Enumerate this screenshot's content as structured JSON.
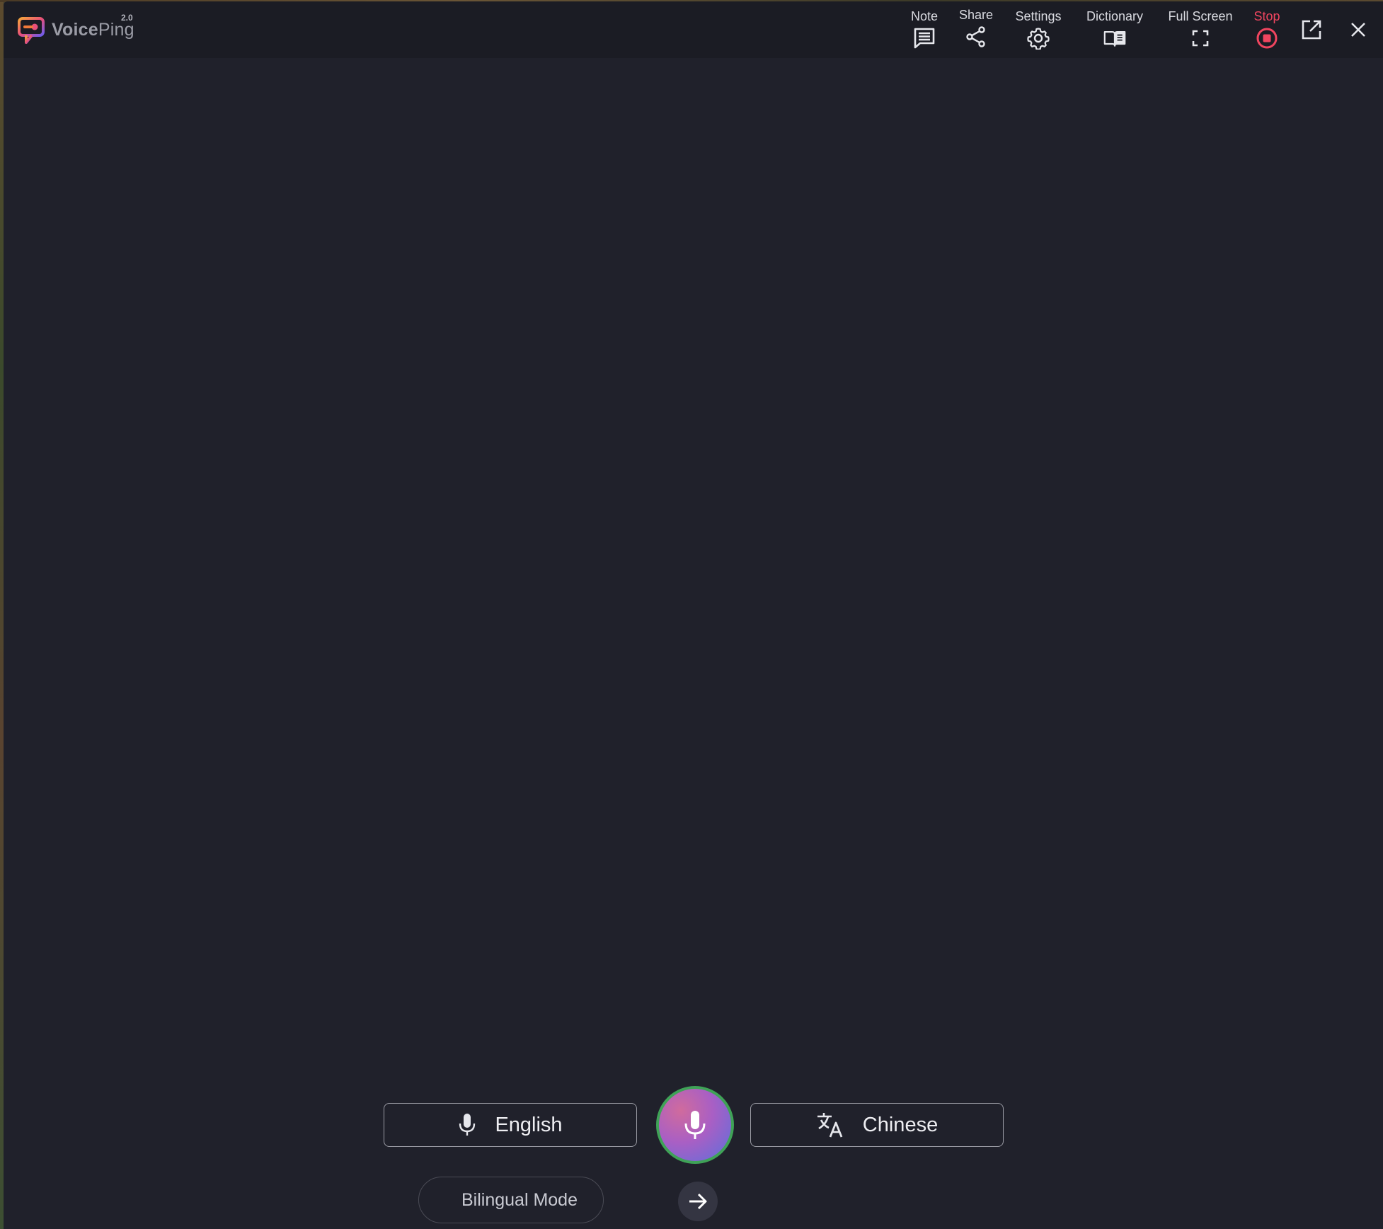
{
  "app": {
    "name_bold": "Voice",
    "name_regular": "Ping",
    "version": "2.0"
  },
  "toolbar": {
    "note": {
      "label": "Note",
      "icon": "note-icon"
    },
    "share": {
      "label": "Share",
      "icon": "share-icon"
    },
    "settings": {
      "label": "Settings",
      "icon": "gear-icon"
    },
    "dictionary": {
      "label": "Dictionary",
      "icon": "book-icon"
    },
    "fullscreen": {
      "label": "Full Screen",
      "icon": "fullscreen-icon"
    },
    "stop": {
      "label": "Stop",
      "icon": "stop-icon"
    },
    "popout": {
      "icon": "external-link-icon"
    },
    "close": {
      "icon": "close-icon"
    }
  },
  "controls": {
    "source_language": "English",
    "target_language": "Chinese",
    "mode_label": "Bilingual Mode"
  },
  "colors": {
    "background": "#20212b",
    "titlebar": "#1b1c24",
    "stop_accent": "#f0455f",
    "mic_ring": "#3fa257"
  }
}
